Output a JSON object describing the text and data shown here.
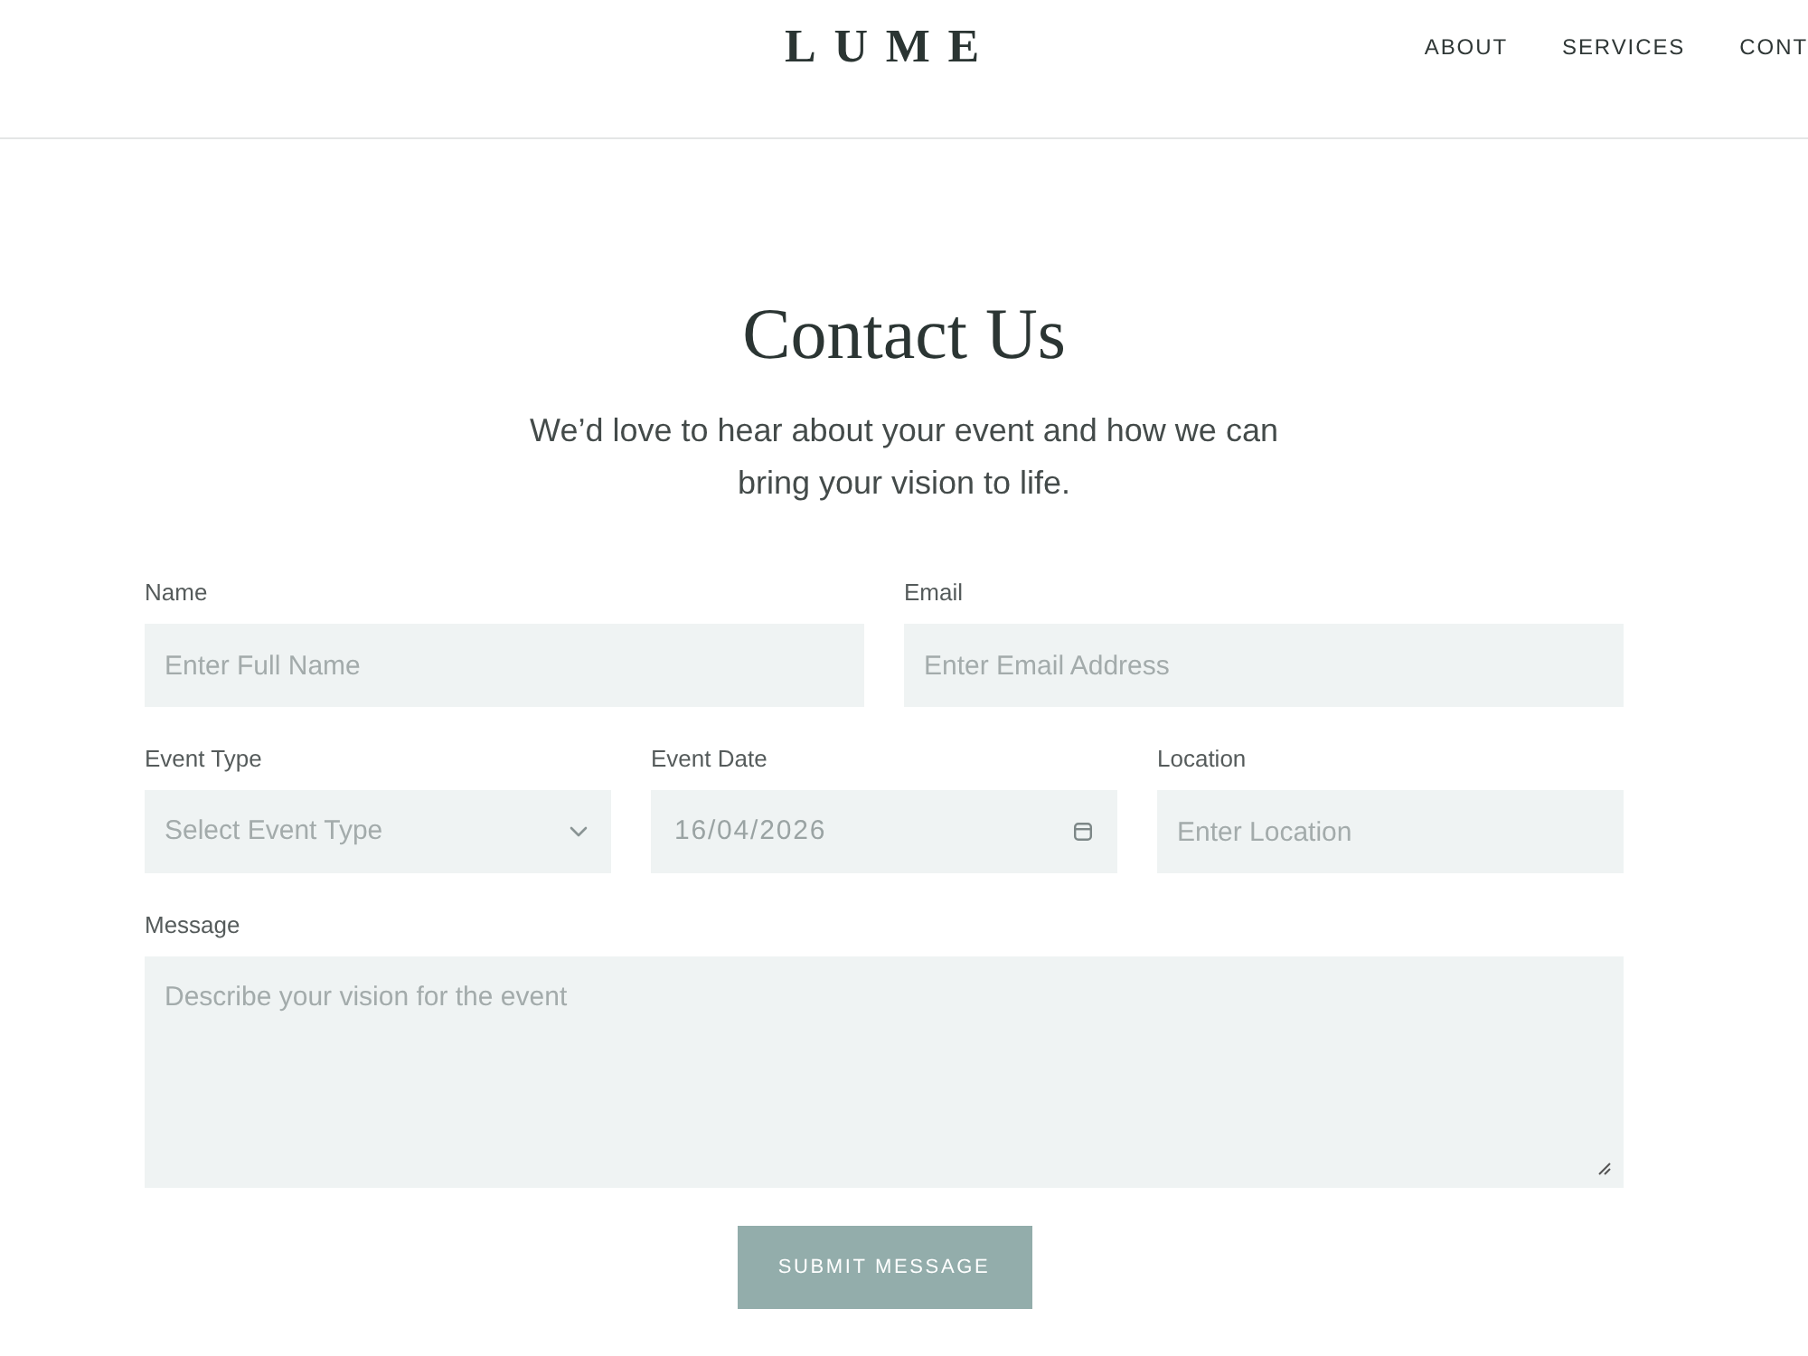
{
  "header": {
    "logo": "LUME",
    "nav": [
      "ABOUT",
      "SERVICES",
      "CONT"
    ]
  },
  "heading": {
    "title": "Contact Us",
    "subtitle": "We’d love to hear about your event and how we can bring your vision to life."
  },
  "form": {
    "rows": [
      [
        {
          "kind": "text",
          "label": "Name",
          "placeholder": "Enter Full Name"
        },
        {
          "kind": "text",
          "label": "Email",
          "placeholder": "Enter Email Address"
        }
      ],
      [
        {
          "kind": "select",
          "label": "Event Type",
          "placeholder": "Select Event Type"
        },
        {
          "kind": "date",
          "label": "Event Date",
          "value": "16/04/2026"
        },
        {
          "kind": "text",
          "label": "Location",
          "placeholder": "Enter Location"
        }
      ],
      [
        {
          "kind": "textarea",
          "label": "Message",
          "placeholder": "Describe your vision for the event"
        }
      ]
    ],
    "submit": "SUBMIT MESSAGE"
  }
}
